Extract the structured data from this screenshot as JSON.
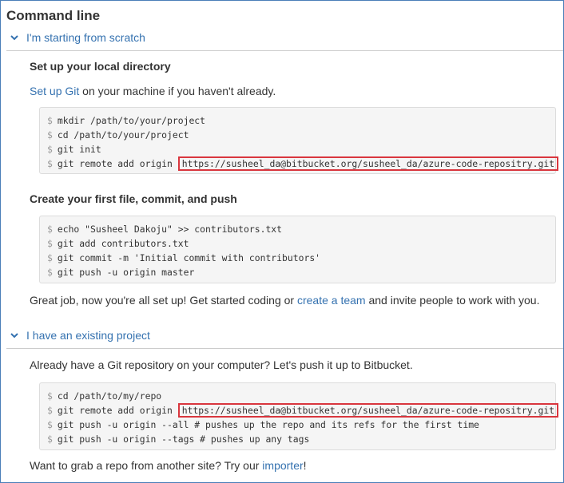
{
  "title": "Command line",
  "sections": {
    "scratch": {
      "header": "I'm starting from scratch",
      "setup_heading": "Set up your local directory",
      "setup_link": "Set up Git",
      "setup_text": " on your machine if you haven't already.",
      "block1": {
        "prompt": "$",
        "lines": [
          "mkdir /path/to/your/project",
          "cd /path/to/your/project",
          "git init",
          "git remote add origin "
        ],
        "url": "https://susheel_da@bitbucket.org/susheel_da/azure-code-repositry.git"
      },
      "commit_heading": "Create your first file, commit, and push",
      "block2": {
        "prompt": "$",
        "lines": [
          "echo \"Susheel Dakoju\" >> contributors.txt",
          "git add contributors.txt",
          "git commit -m 'Initial commit with contributors'",
          "git push -u origin master"
        ]
      },
      "done_text_1": "Great job, now you're all set up! Get started coding or ",
      "done_link": "create a team",
      "done_text_2": " and invite people to work with you."
    },
    "existing": {
      "header": "I have an existing project",
      "intro": "Already have a Git repository on your computer? Let's push it up to Bitbucket.",
      "block": {
        "prompt": "$",
        "lines": [
          "cd /path/to/my/repo",
          "git remote add origin ",
          "git push -u origin --all # pushes up the repo and its refs for the first time",
          "git push -u origin --tags # pushes up any tags"
        ],
        "url": "https://susheel_da@bitbucket.org/susheel_da/azure-code-repositry.git"
      },
      "grab_text_1": "Want to grab a repo from another site? Try our ",
      "grab_link": "importer",
      "grab_text_2": "!"
    }
  },
  "colors": {
    "link": "#3572b0",
    "highlight_border": "#d9363e",
    "frame_border": "#4a7fb8"
  },
  "icons": {
    "section_toggle": "chevron-down-icon"
  }
}
